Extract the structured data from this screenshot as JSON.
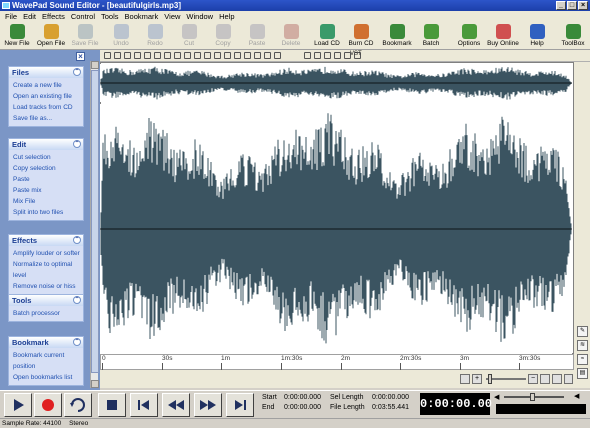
{
  "window": {
    "title": "WavePad Sound Editor - [beautifulgirls.mp3]"
  },
  "menu": [
    "File",
    "Edit",
    "Effects",
    "Control",
    "Tools",
    "Bookmark",
    "View",
    "Window",
    "Help"
  ],
  "toolbar": [
    {
      "label": "New File",
      "icon": "new-file-icon",
      "color": "#3a8a3a",
      "enabled": true
    },
    {
      "label": "Open File",
      "icon": "open-file-icon",
      "color": "#d8a030",
      "enabled": true
    },
    {
      "label": "Save File",
      "icon": "save-file-icon",
      "color": "#6080a0",
      "enabled": false
    },
    {
      "label": "Undo",
      "icon": "undo-icon",
      "color": "#6080c0",
      "enabled": false
    },
    {
      "label": "Redo",
      "icon": "redo-icon",
      "color": "#6080c0",
      "enabled": false
    },
    {
      "label": "Cut",
      "icon": "cut-icon",
      "color": "#8080a0",
      "enabled": false
    },
    {
      "label": "Copy",
      "icon": "copy-icon",
      "color": "#8080a0",
      "enabled": false
    },
    {
      "label": "Paste",
      "icon": "paste-icon",
      "color": "#8080a0",
      "enabled": false
    },
    {
      "label": "Delete",
      "icon": "delete-icon",
      "color": "#a04040",
      "enabled": false
    },
    {
      "label": "Load CD",
      "icon": "load-cd-icon",
      "color": "#3a9a6a",
      "enabled": true
    },
    {
      "label": "Burn CD",
      "icon": "burn-cd-icon",
      "color": "#d07030",
      "enabled": true
    },
    {
      "label": "Bookmark",
      "icon": "bookmark-icon",
      "color": "#3a8a3a",
      "enabled": true
    },
    {
      "label": "Batch",
      "icon": "batch-icon",
      "color": "#4a9a3a",
      "enabled": true
    },
    {
      "label": "Options",
      "icon": "options-icon",
      "color": "#4a9a3a",
      "enabled": true
    },
    {
      "label": "Buy Online",
      "icon": "buy-online-icon",
      "color": "#d05050",
      "enabled": true
    },
    {
      "label": "Help",
      "icon": "help-icon",
      "color": "#3060c0",
      "enabled": true
    },
    {
      "label": "ToolBox",
      "icon": "toolbox-icon",
      "color": "#3a8a3a",
      "enabled": true
    }
  ],
  "sidebar": {
    "panels": [
      {
        "title": "Files",
        "items": [
          "Create a new file",
          "Open an existing file",
          "Load tracks from CD",
          "Save file as..."
        ]
      },
      {
        "title": "Edit",
        "items": [
          "Cut selection",
          "Copy selection",
          "Paste",
          "Paste mix",
          "Mix File",
          "Split into two files"
        ]
      },
      {
        "title": "Effects",
        "items": [
          "Amplify louder or softer",
          "Normalize to optimal level",
          "Remove noise or hiss"
        ]
      },
      {
        "title": "Tools",
        "items": [
          "Batch processor"
        ]
      },
      {
        "title": "Bookmark",
        "items": [
          "Bookmark current position",
          "Open bookmarks list"
        ]
      }
    ]
  },
  "edit_tools": [
    "VST"
  ],
  "timeline": {
    "ticks": [
      "0",
      "30s",
      "1m",
      "1m:30s",
      "2m",
      "2m:30s",
      "3m",
      "3m:30s"
    ]
  },
  "info": {
    "start_label": "Start",
    "start_value": "0:00:00.000",
    "end_label": "End",
    "end_value": "0:00:00.000",
    "sel_length_label": "Sel Length",
    "sel_length_value": "0:00:00.000",
    "file_length_label": "File Length",
    "file_length_value": "0:03:55.441"
  },
  "current_time": "0:00:00.00",
  "status": {
    "sample_rate": "Sample Rate: 44100",
    "channels": "Stereo"
  },
  "colors": {
    "waveform": "#3b5461",
    "sidebar": "#7b96c6",
    "link": "#2050b0"
  }
}
